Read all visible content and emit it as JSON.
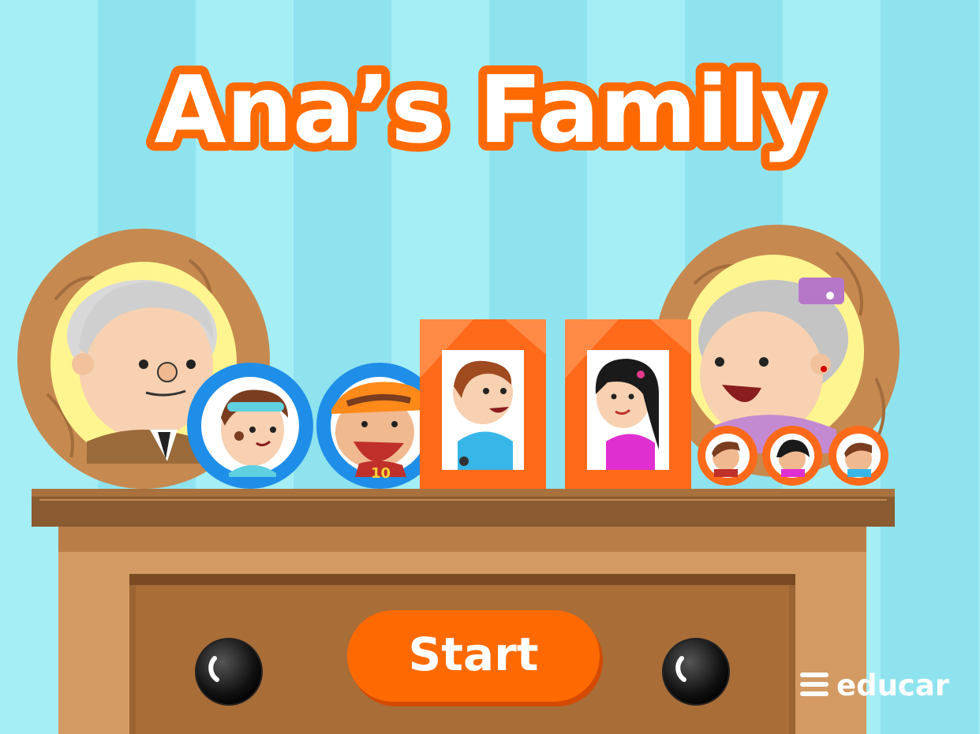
{
  "game": {
    "title": "Ana’s Family",
    "start_label": "Start",
    "brand": "educar"
  },
  "colors": {
    "wall_light": "#a5eef6",
    "wall_dark": "#8fe3ef",
    "title_orange": "#ff6a00",
    "wood_dark": "#8a5a30",
    "wood_mid": "#b27a4a",
    "wood_light": "#d39a63",
    "frame_blue": "#1f8ee8",
    "frame_orange": "#ff6a1a"
  },
  "icons": {
    "brand": "educar-logo-icon",
    "knob": "drawer-knob-icon"
  }
}
